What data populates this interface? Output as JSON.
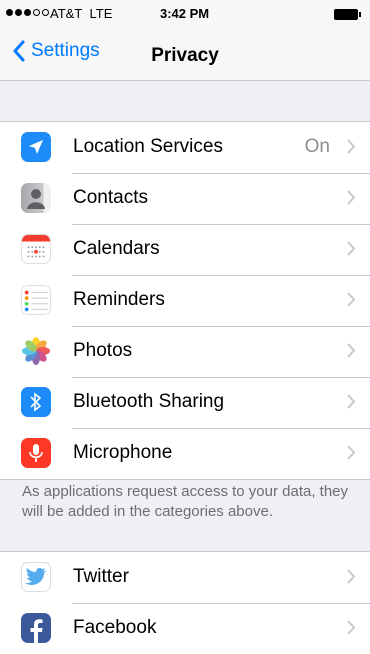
{
  "status_bar": {
    "carrier": "AT&T",
    "network": "LTE",
    "time": "3:42 PM"
  },
  "nav": {
    "back_label": "Settings",
    "title": "Privacy"
  },
  "group1": {
    "items": [
      {
        "label": "Location Services",
        "value": "On",
        "icon": "location-arrow-icon"
      },
      {
        "label": "Contacts",
        "value": "",
        "icon": "contacts-icon"
      },
      {
        "label": "Calendars",
        "value": "",
        "icon": "calendar-icon"
      },
      {
        "label": "Reminders",
        "value": "",
        "icon": "reminders-icon"
      },
      {
        "label": "Photos",
        "value": "",
        "icon": "photos-icon"
      },
      {
        "label": "Bluetooth Sharing",
        "value": "",
        "icon": "bluetooth-icon"
      },
      {
        "label": "Microphone",
        "value": "",
        "icon": "microphone-icon"
      }
    ],
    "footer": "As applications request access to your data, they will be added in the categories above."
  },
  "group2": {
    "items": [
      {
        "label": "Twitter",
        "icon": "twitter-icon"
      },
      {
        "label": "Facebook",
        "icon": "facebook-icon"
      }
    ]
  },
  "colors": {
    "accent": "#007aff",
    "location": "#1d8cf8",
    "bluetooth": "#1d8cf8",
    "microphone": "#fe3824",
    "facebook": "#3b5998",
    "twitter": "#55acee"
  }
}
